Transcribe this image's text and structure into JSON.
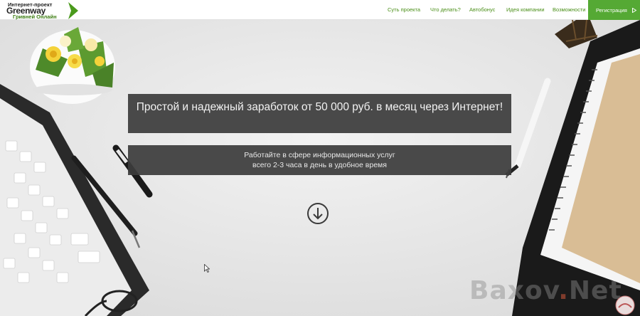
{
  "logo": {
    "line1": "Интернет-проект",
    "line2": "Greenway",
    "line3": "Гривней Онлайн"
  },
  "nav": {
    "items": [
      {
        "label": "Суть проекта"
      },
      {
        "label": "Что делать?"
      },
      {
        "label": "Автобонус"
      },
      {
        "label": "Идея компании"
      },
      {
        "label": "Возможности"
      }
    ],
    "register_label": "Регистрация"
  },
  "hero": {
    "title": "Простой и надежный заработок от 50 000 руб. в месяц через Интернет!",
    "subtitle_line1": "Работайте в сфере информационных услуг",
    "subtitle_line2": "всего 2-3 часа в день в удобное время"
  },
  "watermark": {
    "part1": "Baxov",
    "dot": ".",
    "part2": "Net"
  },
  "colors": {
    "accent": "#55a934",
    "nav_text": "#4a8f18",
    "banner_bg": "#3c3c3c"
  },
  "icons": {
    "scroll": "arrow-down-circle-icon",
    "register": "play-triangle-icon"
  }
}
